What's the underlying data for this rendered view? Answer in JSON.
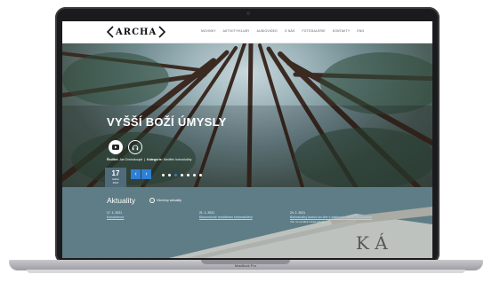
{
  "site": {
    "logo_text": "ARCHA",
    "nav": [
      "NOVINKY",
      "AKTIVITY/KLUBY",
      "AUDIOVIDEO",
      "O NÁS",
      "FOTOGALERIE",
      "KONTAKTY",
      "ENG"
    ]
  },
  "hero": {
    "title": "VYŠŠÍ BOŽÍ ÚMYSLY",
    "author_label": "Ředitel:",
    "author": "Jan Drahokoupil",
    "category_label": "Kategorie:",
    "category": "Nedělní bohoslužby",
    "date": {
      "day": "17",
      "month": "ledna",
      "year": "2021"
    },
    "arrow_prev": "‹",
    "arrow_next": "›",
    "dots_count": 7,
    "active_dot": 2
  },
  "news": {
    "title": "Aktuality",
    "all_label": "Všechny aktuality",
    "items": [
      {
        "date": "17. 1. 2021",
        "title": "Kondolence",
        "sub": ""
      },
      {
        "date": "21. 1. 2021",
        "title": "Ekumenické modlitební shromáždění",
        "sub": ""
      },
      {
        "date": "24. 1. 2021",
        "title": "Bohoslužby budou on-line v malinové sálové bohoslužbě",
        "sub": "Vše na sociální média aktuál."
      }
    ]
  },
  "device": {
    "label": "MacBook Pro"
  },
  "colors": {
    "accent": "#2f7fd6",
    "date_box": "#4f6a78",
    "link": "#9cd4ff"
  }
}
